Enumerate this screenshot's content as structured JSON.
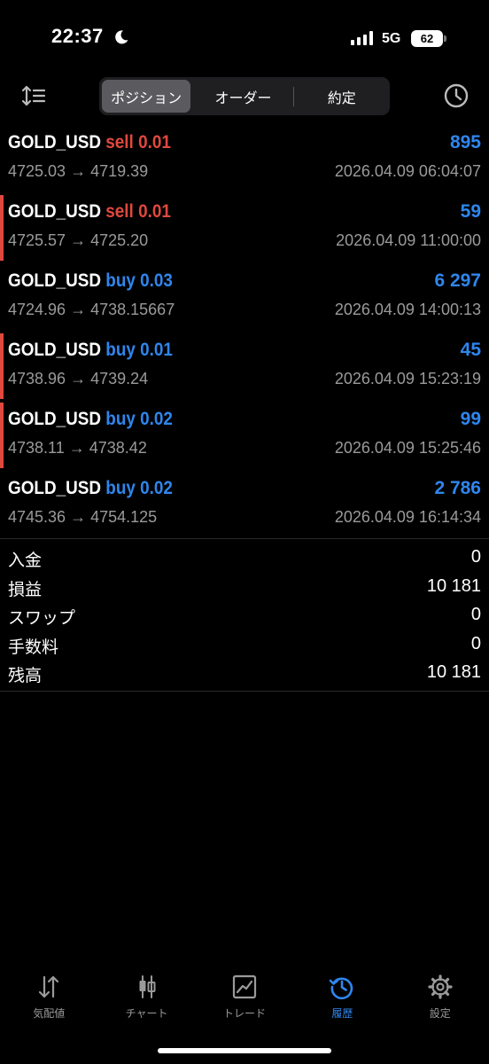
{
  "status_bar": {
    "time": "22:37",
    "network": "5G",
    "battery": "62"
  },
  "tabs": [
    {
      "label": "ポジション",
      "active": true
    },
    {
      "label": "オーダー",
      "active": false
    },
    {
      "label": "約定",
      "active": false
    }
  ],
  "deals": [
    {
      "symbol": "GOLD_USD",
      "side": "sell",
      "volume": "0.01",
      "profit": "895",
      "open_price": "4725.03",
      "close_price": "4719.39",
      "time": "2026.04.09 06:04:07",
      "marked": false
    },
    {
      "symbol": "GOLD_USD",
      "side": "sell",
      "volume": "0.01",
      "profit": "59",
      "open_price": "4725.57",
      "close_price": "4725.20",
      "time": "2026.04.09 11:00:00",
      "marked": true
    },
    {
      "symbol": "GOLD_USD",
      "side": "buy",
      "volume": "0.03",
      "profit": "6 297",
      "open_price": "4724.96",
      "close_price": "4738.15667",
      "time": "2026.04.09 14:00:13",
      "marked": false
    },
    {
      "symbol": "GOLD_USD",
      "side": "buy",
      "volume": "0.01",
      "profit": "45",
      "open_price": "4738.96",
      "close_price": "4739.24",
      "time": "2026.04.09 15:23:19",
      "marked": true
    },
    {
      "symbol": "GOLD_USD",
      "side": "buy",
      "volume": "0.02",
      "profit": "99",
      "open_price": "4738.11",
      "close_price": "4738.42",
      "time": "2026.04.09 15:25:46",
      "marked": true
    },
    {
      "symbol": "GOLD_USD",
      "side": "buy",
      "volume": "0.02",
      "profit": "2 786",
      "open_price": "4745.36",
      "close_price": "4754.125",
      "time": "2026.04.09 16:14:34",
      "marked": false
    }
  ],
  "arrow": "→",
  "summary": [
    {
      "label": "入金",
      "value": "0"
    },
    {
      "label": "損益",
      "value": "10 181"
    },
    {
      "label": "スワップ",
      "value": "0"
    },
    {
      "label": "手数料",
      "value": "0"
    },
    {
      "label": "残高",
      "value": "10 181"
    }
  ],
  "nav": [
    {
      "label": "気配値",
      "icon": "quotes-icon",
      "active": false
    },
    {
      "label": "チャート",
      "icon": "chart-candles-icon",
      "active": false
    },
    {
      "label": "トレード",
      "icon": "trade-icon",
      "active": false
    },
    {
      "label": "履歴",
      "icon": "history-icon",
      "active": true
    },
    {
      "label": "設定",
      "icon": "settings-icon",
      "active": false
    }
  ],
  "colors": {
    "sell": "#e0483e",
    "buy": "#2f86ee",
    "profit": "#2f86ee",
    "muted": "#9a9a9a",
    "marker": "#e0483e"
  }
}
